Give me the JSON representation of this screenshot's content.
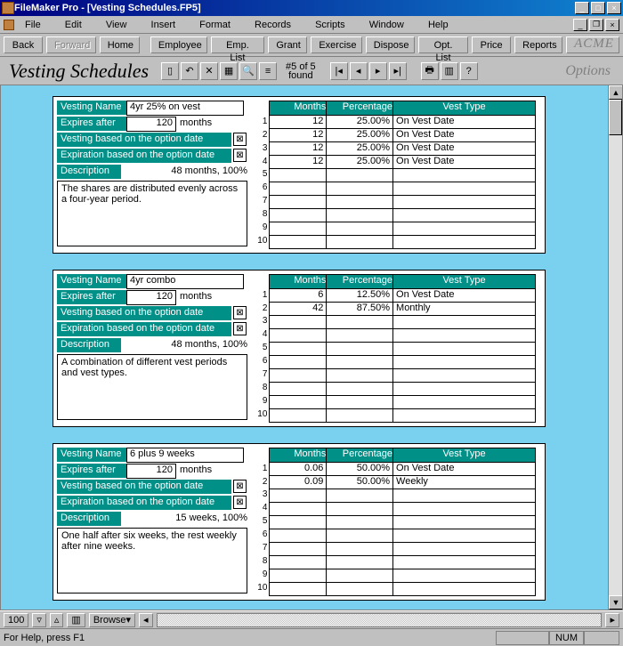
{
  "window": {
    "title": "FileMaker Pro - [Vesting Schedules.FP5]"
  },
  "menu": {
    "items": [
      "File",
      "Edit",
      "View",
      "Insert",
      "Format",
      "Records",
      "Scripts",
      "Window",
      "Help"
    ]
  },
  "toolbar1": {
    "back": "Back",
    "forward": "Forward",
    "home": "Home",
    "buttons": [
      "Employee",
      "Emp. List",
      "Grant",
      "Exercise",
      "Dispose",
      "Opt. List",
      "Price",
      "Reports"
    ],
    "brand": "ACME"
  },
  "toolbar2": {
    "page_title": "Vesting Schedules",
    "record_status_top": "#5 of 5",
    "record_status_bottom": "found",
    "options": "Options"
  },
  "labels": {
    "vesting_name": "Vesting Name",
    "expires_after": "Expires after",
    "vesting_option": "Vesting based on the option date",
    "expiration_option": "Expiration based on the option date",
    "description": "Description",
    "grid_months": "Months",
    "grid_pct": "Percentage",
    "grid_type": "Vest Type",
    "months_unit": "months"
  },
  "records": [
    {
      "name": "4yr 25% on vest",
      "expires": "120",
      "vest_opt_checked": true,
      "exp_opt_checked": true,
      "desc_summary": "48 months, 100%",
      "description": "The shares are distributed evenly across a four-year period.",
      "rows": [
        {
          "m": "12",
          "p": "25.00%",
          "t": "On Vest Date"
        },
        {
          "m": "12",
          "p": "25.00%",
          "t": "On Vest Date"
        },
        {
          "m": "12",
          "p": "25.00%",
          "t": "On Vest Date"
        },
        {
          "m": "12",
          "p": "25.00%",
          "t": "On Vest Date"
        },
        {},
        {},
        {},
        {},
        {},
        {}
      ]
    },
    {
      "name": "4yr combo",
      "expires": "120",
      "vest_opt_checked": true,
      "exp_opt_checked": true,
      "desc_summary": "48 months, 100%",
      "description": "A combination of different vest periods and vest types.",
      "rows": [
        {
          "m": "6",
          "p": "12.50%",
          "t": "On Vest Date"
        },
        {
          "m": "42",
          "p": "87.50%",
          "t": "Monthly"
        },
        {},
        {},
        {},
        {},
        {},
        {},
        {},
        {}
      ]
    },
    {
      "name": "6 plus 9 weeks",
      "expires": "120",
      "vest_opt_checked": true,
      "exp_opt_checked": true,
      "desc_summary": "15 weeks, 100%",
      "description": "One half after six weeks, the rest weekly after nine weeks.",
      "rows": [
        {
          "m": "0.06",
          "p": "50.00%",
          "t": "On Vest Date"
        },
        {
          "m": "0.09",
          "p": "50.00%",
          "t": "Weekly"
        },
        {},
        {},
        {},
        {},
        {},
        {},
        {},
        {}
      ]
    }
  ],
  "status": {
    "zoom": "100",
    "mode": "Browse",
    "help_text": "For Help, press F1",
    "num": "NUM"
  }
}
